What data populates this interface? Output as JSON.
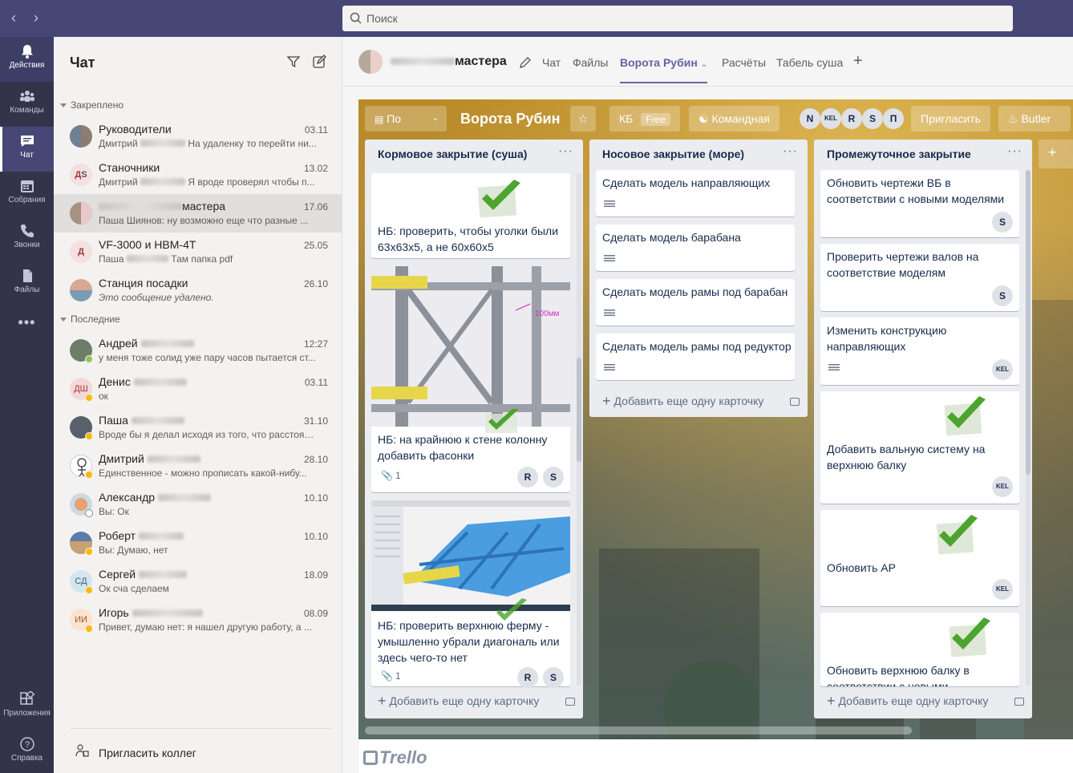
{
  "search": {
    "placeholder": "Поиск"
  },
  "rail": [
    {
      "label": "Действия",
      "icon": "bell-icon"
    },
    {
      "label": "Команды",
      "icon": "teams-icon"
    },
    {
      "label": "Чат",
      "icon": "chat-icon"
    },
    {
      "label": "Собрания",
      "icon": "calendar-icon"
    },
    {
      "label": "Звонки",
      "icon": "phone-icon"
    },
    {
      "label": "Файлы",
      "icon": "files-icon"
    },
    {
      "label": "...",
      "icon": "more-icon"
    },
    {
      "label": "Приложения",
      "icon": "apps-icon"
    },
    {
      "label": "Справка",
      "icon": "help-icon"
    }
  ],
  "chat": {
    "title": "Чат",
    "pinned_label": "Закреплено",
    "recent_label": "Последние",
    "pinned": [
      {
        "name": "Руководители",
        "time": "03.11",
        "preview_a": "Дмитрий",
        "preview_b": "На удаленку то перейти ни..."
      },
      {
        "name": "Станочники",
        "time": "13.02",
        "preview_a": "Дмитрий",
        "preview_b": "Я вроде проверял чтобы п..."
      },
      {
        "name": "мастера",
        "time": "17.06",
        "preview_a": "",
        "preview_b": "Паша Шиянов: ну возможно еще что разные ..."
      },
      {
        "name": "VF-3000 и HBM-4T",
        "time": "25.05",
        "preview_a": "Паша",
        "preview_b": "Там папка pdf"
      },
      {
        "name": "Станция посадки",
        "time": "26.10",
        "preview_a": "",
        "preview_b": "Это сообщение удалено."
      }
    ],
    "recent": [
      {
        "name": "Андрей",
        "time": "12:27",
        "preview": "у меня тоже солид уже пару часов пытается ст...",
        "initials": ""
      },
      {
        "name": "Денис",
        "time": "03.11",
        "preview": "ок",
        "initials": "ДШ"
      },
      {
        "name": "Паша",
        "time": "31.10",
        "preview": "Вроде бы я делал исходя из того, что расстоян...",
        "initials": ""
      },
      {
        "name": "Дмитрий",
        "time": "28.10",
        "preview": "Единственное - можно прописать какой-нибу...",
        "initials": ""
      },
      {
        "name": "Александр",
        "time": "10.10",
        "preview": "Вы: Ок",
        "initials": ""
      },
      {
        "name": "Роберт",
        "time": "10.10",
        "preview": "Вы: Думаю, нет",
        "initials": ""
      },
      {
        "name": "Сергей",
        "time": "18.09",
        "preview": "Ок сча сделаем",
        "initials": "СД"
      },
      {
        "name": "Игорь",
        "time": "08.09",
        "preview": "Привет, думаю нет: я нашел другую работу, а ...",
        "initials": "ИИ"
      }
    ],
    "invite": "Пригласить коллег"
  },
  "channel": {
    "title": "мастера",
    "tabs": [
      "Чат",
      "Файлы",
      "Ворота Рубин",
      "Расчёты",
      "Табель суша"
    ],
    "active_tab": "Ворота Рубин"
  },
  "board": {
    "view": "По",
    "name": "Ворота Рубин",
    "kb": "КБ",
    "free": "Free",
    "team": "Командная",
    "members": [
      "N",
      "KEL",
      "R",
      "S",
      "П"
    ],
    "invite": "Пригласить",
    "butler": "Butler",
    "footer_logo": "Trello",
    "add_card": "Добавить еще одну карточку",
    "lists": [
      {
        "title": "Кормовое закрытие (суша)",
        "cards": [
          {
            "text": "НБ: проверить, чтобы уголки были 63х63х5, а не 60х60х5"
          },
          {
            "text": "НБ: на крайнюю к стене колонну добавить фасонки",
            "attachments": "1",
            "members": [
              "R",
              "S"
            ],
            "image_note": "100мм"
          },
          {
            "text": "НБ: проверить верхнюю ферму - умышленно убрали диагональ или здесь чего-то нет",
            "attachments": "1",
            "members": [
              "R",
              "S"
            ]
          }
        ]
      },
      {
        "title": "Носовое закрытие (море)",
        "cards": [
          {
            "text": "Сделать модель направляющих"
          },
          {
            "text": "Сделать модель барабана"
          },
          {
            "text": "Сделать модель рамы под барабан"
          },
          {
            "text": "Сделать модель рамы под редуктор"
          }
        ]
      },
      {
        "title": "Промежуточное закрытие",
        "cards": [
          {
            "text": "Обновить чертежи ВБ в соответствии с новыми моделями",
            "member": "S"
          },
          {
            "text": "Проверить чертежи валов на соответствие моделям",
            "member": "S"
          },
          {
            "text": "Изменить конструкцию направляющих",
            "member": "KEL"
          },
          {
            "text": "Добавить вальную систему на верхнюю балку",
            "member": "KEL"
          },
          {
            "text": "Обновить АР",
            "member": "KEL"
          },
          {
            "text": "Обновить верхнюю балку в соответствии с новыми"
          }
        ]
      }
    ]
  },
  "colors": {
    "teams_purple": "#6264a7",
    "rail": "#33344a",
    "topbar": "#464775",
    "online": "#92c353",
    "away": "#fcb80b"
  }
}
